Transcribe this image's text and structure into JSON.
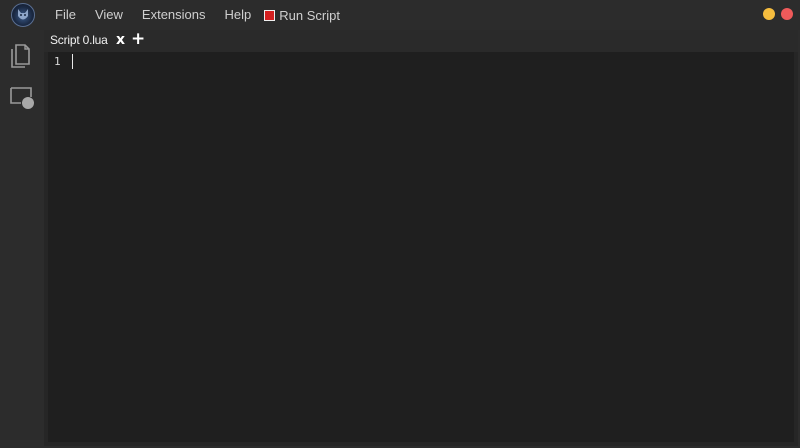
{
  "menubar": {
    "items": [
      "File",
      "View",
      "Extensions",
      "Help"
    ],
    "run_script_label": "Run Script"
  },
  "window_controls": {
    "minimize_color": "#f6bd3e",
    "close_color": "#ef5a5a"
  },
  "sidebar": {
    "items": [
      {
        "icon": "files-icon"
      },
      {
        "icon": "screen-record-icon"
      }
    ]
  },
  "editor": {
    "tab_label": "Script 0.lua",
    "close_tab_glyph": "x",
    "add_tab_glyph": "+",
    "line_numbers": [
      "1"
    ]
  },
  "colors": {
    "run_indicator": "#d42020",
    "editor_bg": "#1f1f1f",
    "chrome_bg": "#2c2c2c"
  }
}
